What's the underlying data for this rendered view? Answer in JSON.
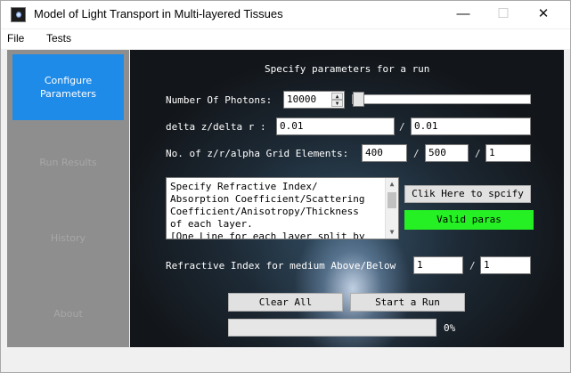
{
  "window": {
    "title": "Model of Light Transport in Multi-layered Tissues",
    "minimize_glyph": "—",
    "maximize_glyph": "☐",
    "close_glyph": "✕"
  },
  "menu": [
    "File",
    "Tests"
  ],
  "nav": {
    "items": [
      "Configure\nParameters",
      "Run Results",
      "History",
      "About"
    ],
    "active_index": 0
  },
  "form": {
    "heading": "Specify parameters for a run",
    "photons": {
      "label": "Number Of Photons:",
      "value": "10000",
      "slider_fraction": 0
    },
    "delta": {
      "label": "delta z/delta r :",
      "dz": "0.01",
      "dr": "0.01"
    },
    "grid": {
      "label": "No. of z/r/alpha Grid Elements:",
      "z": "400",
      "r": "500",
      "alpha": "1"
    },
    "layers_text": "Specify Refractive Index/\nAbsorption Coefficient/Scattering\nCoefficient/Anisotropy/Thickness\nof each layer.\n[One Line for each layer split by",
    "spec_button": "Clik Here to spcify",
    "valid_label": "Valid paras",
    "medium": {
      "label": "Refractive Index for medium Above/Below",
      "above": "1",
      "below": "1"
    },
    "clear_button": "Clear All",
    "start_button": "Start a Run",
    "progress": {
      "value": 0,
      "text": "0%"
    },
    "separator": "/"
  },
  "colors": {
    "nav_active": "#1f8be8",
    "nav_bg": "#8e8e8e",
    "valid": "#24f023",
    "panel_dark": "#1c2833"
  }
}
